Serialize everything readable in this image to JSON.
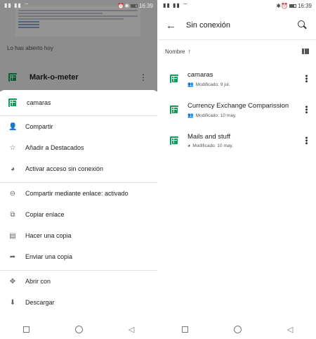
{
  "left": {
    "status": {
      "signal": "▮▮ ▮▮ ⌔",
      "time": "16:39"
    },
    "recent_label": "Lo has abierto hoy",
    "background_file": {
      "name": "Mark-o-meter"
    },
    "sheet": {
      "file_name": "camaras",
      "group1": [
        {
          "icon": "person-add-icon",
          "glyph": "👤",
          "label": "Compartir"
        },
        {
          "icon": "star-icon",
          "glyph": "☆",
          "label": "Añadir a Destacados"
        },
        {
          "icon": "offline-icon",
          "glyph": "◕",
          "label": "Activar acceso sin conexión"
        }
      ],
      "group2": [
        {
          "icon": "link-icon",
          "glyph": "⊖",
          "label": "Compartir mediante enlace: activado"
        },
        {
          "icon": "copy-icon",
          "glyph": "⧉",
          "label": "Copiar enlace"
        },
        {
          "icon": "duplicate-icon",
          "glyph": "▤",
          "label": "Hacer una copia"
        },
        {
          "icon": "forward-icon",
          "glyph": "➦",
          "label": "Enviar una copia"
        }
      ],
      "group3": [
        {
          "icon": "open-with-icon",
          "glyph": "✥",
          "label": "Abrir con"
        },
        {
          "icon": "download-icon",
          "glyph": "⬇",
          "label": "Descargar"
        }
      ]
    }
  },
  "right": {
    "status": {
      "signal": "▮▮ ▮▮ ⌔",
      "time": "16:39"
    },
    "title": "Sin conexión",
    "sort_label": "Nombre",
    "files": [
      {
        "name": "camaras",
        "meta_icon": "shared-icon",
        "meta_glyph": "👥",
        "modified": "Modificado: 9 jul."
      },
      {
        "name": "Currency Exchange Comparission",
        "meta_icon": "shared-icon",
        "meta_glyph": "👥",
        "modified": "Modificado: 10 may."
      },
      {
        "name": "Mails and stuff",
        "meta_icon": "offline-icon",
        "meta_glyph": "◕",
        "modified": "Modificado: 10 may."
      }
    ]
  }
}
